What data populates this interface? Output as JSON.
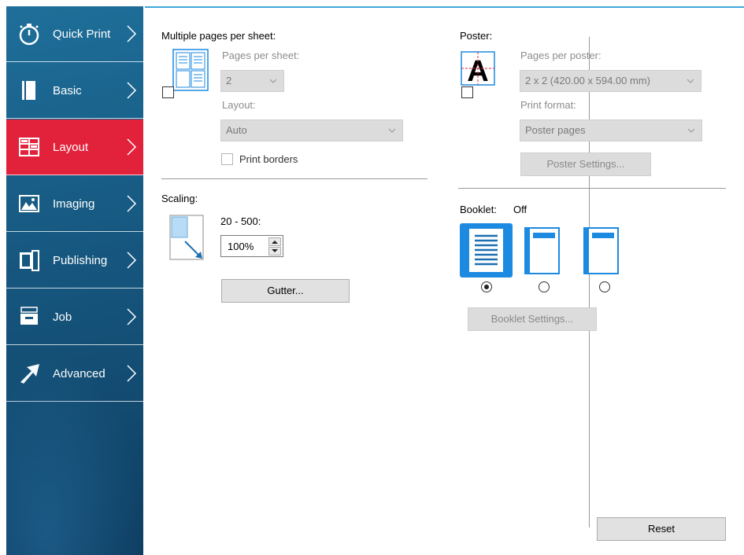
{
  "sidebar": {
    "items": [
      {
        "label": "Quick Print",
        "icon": "stopwatch-icon"
      },
      {
        "label": "Basic",
        "icon": "page-icon"
      },
      {
        "label": "Layout",
        "icon": "layout-grid-icon"
      },
      {
        "label": "Imaging",
        "icon": "image-icon"
      },
      {
        "label": "Publishing",
        "icon": "book-icon"
      },
      {
        "label": "Job",
        "icon": "job-tray-icon"
      },
      {
        "label": "Advanced",
        "icon": "arrow-icon"
      }
    ],
    "active": "Layout"
  },
  "multipage": {
    "title": "Multiple pages per sheet:",
    "pages_label": "Pages per sheet:",
    "pages_value": "2",
    "layout_label": "Layout:",
    "layout_value": "Auto",
    "print_borders_label": "Print borders"
  },
  "scaling": {
    "title": "Scaling:",
    "range_label": "20 - 500:",
    "value": "100%",
    "gutter_button": "Gutter..."
  },
  "poster": {
    "title": "Poster:",
    "pages_label": "Pages per poster:",
    "pages_value": "2 x 2 (420.00 x 594.00 mm)",
    "format_label": "Print format:",
    "format_value": "Poster pages",
    "settings_button": "Poster Settings..."
  },
  "booklet": {
    "title": "Booklet:",
    "status": "Off",
    "settings_button": "Booklet Settings..."
  },
  "reset_button": "Reset",
  "colors": {
    "sidebar": "#16577f",
    "active": "#e2223b",
    "accent": "#1c8ae0"
  }
}
